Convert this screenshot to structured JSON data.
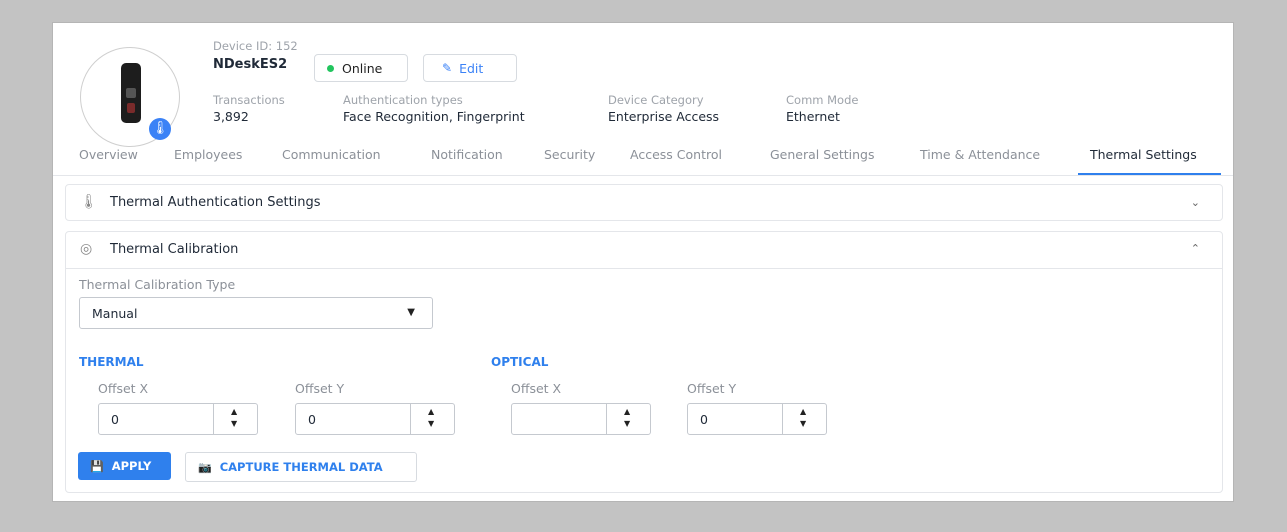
{
  "device": {
    "id_label": "Device ID: 152",
    "name": "NDeskES2",
    "status": "Online",
    "edit_label": "Edit",
    "meta": [
      {
        "label": "Transactions",
        "value": "3,892"
      },
      {
        "label": "Authentication types",
        "value": "Face Recognition, Fingerprint"
      },
      {
        "label": "Device Category",
        "value": "Enterprise Access"
      },
      {
        "label": "Comm Mode",
        "value": "Ethernet"
      }
    ]
  },
  "tabs": [
    "Overview",
    "Employees",
    "Communication",
    "Notification",
    "Security",
    "Access Control",
    "General Settings",
    "Time & Attendance",
    "Thermal Settings"
  ],
  "active_tab": "Thermal Settings",
  "panels": {
    "thermal_auth": {
      "title": "Thermal Authentication Settings",
      "icon": "thermometer-icon",
      "expanded": false
    },
    "thermal_calibration": {
      "title": "Thermal Calibration",
      "icon": "calibration-icon",
      "expanded": true
    }
  },
  "calibration": {
    "type_label": "Thermal Calibration Type",
    "type_value": "Manual",
    "thermal": {
      "title": "THERMAL",
      "offset_x_label": "Offset X",
      "offset_x": "0",
      "offset_y_label": "Offset Y",
      "offset_y": "0"
    },
    "optical": {
      "title": "OPTICAL",
      "offset_x_label": "Offset X",
      "offset_x": "",
      "offset_y_label": "Offset Y",
      "offset_y": "0"
    },
    "apply_label": "APPLY",
    "capture_label": "CAPTURE THERMAL DATA"
  },
  "colors": {
    "accent": "#2f80ed",
    "online": "#22c55e",
    "page_bg": "#c3c3c3"
  }
}
